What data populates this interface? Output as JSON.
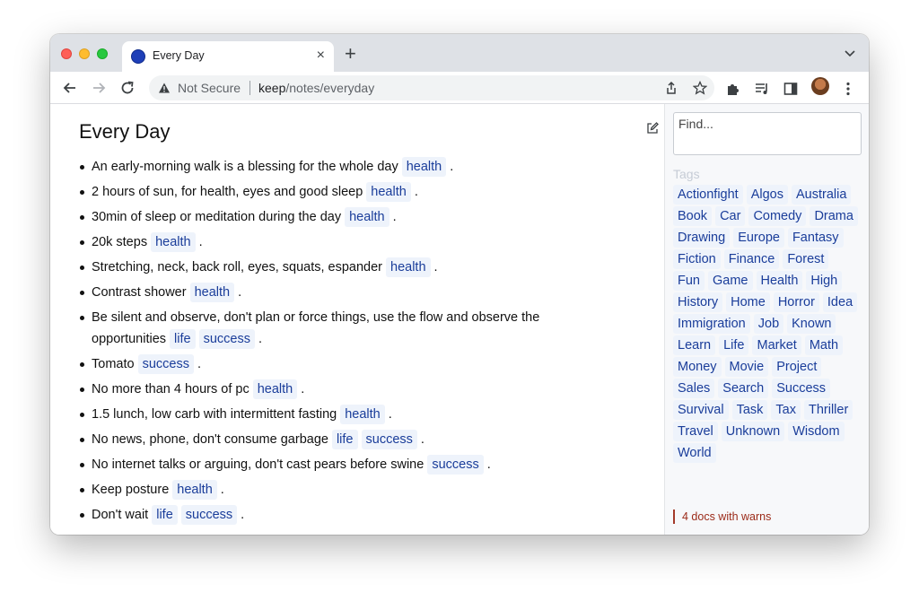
{
  "browser": {
    "tab_title": "Every Day",
    "tab_close": "×",
    "new_tab": "+",
    "security_label": "Not Secure",
    "url_host": "keep",
    "url_path": "/notes/everyday"
  },
  "page": {
    "title": "Every Day"
  },
  "notes": [
    {
      "text": "An early-morning walk is a blessing for the whole day",
      "tags": [
        "health"
      ]
    },
    {
      "text": "2 hours of sun, for health, eyes and good sleep",
      "tags": [
        "health"
      ]
    },
    {
      "text": "30min of sleep or meditation during the day",
      "tags": [
        "health"
      ]
    },
    {
      "text": "20k steps",
      "tags": [
        "health"
      ]
    },
    {
      "text": "Stretching, neck, back roll, eyes, squats, espander",
      "tags": [
        "health"
      ]
    },
    {
      "text": "Contrast shower",
      "tags": [
        "health"
      ]
    },
    {
      "text": "Be silent and observe, don't plan or force things, use the flow and observe the opportunities",
      "tags": [
        "life",
        "success"
      ]
    },
    {
      "text": "Tomato",
      "tags": [
        "success"
      ]
    },
    {
      "text": "No more than 4 hours of pc",
      "tags": [
        "health"
      ]
    },
    {
      "text": "1.5 lunch, low carb with intermittent fasting",
      "tags": [
        "health"
      ]
    },
    {
      "text": "No news, phone, don't consume garbage",
      "tags": [
        "life",
        "success"
      ]
    },
    {
      "text": "No internet talks or arguing, don't cast pears before swine",
      "tags": [
        "success"
      ]
    },
    {
      "text": "Keep posture",
      "tags": [
        "health"
      ]
    },
    {
      "text": "Don't wait",
      "tags": [
        "life",
        "success"
      ]
    }
  ],
  "sidebar": {
    "find_placeholder": "Find...",
    "tags_label": "Tags",
    "tags": [
      "Actionfight",
      "Algos",
      "Australia",
      "Book",
      "Car",
      "Comedy",
      "Drama",
      "Drawing",
      "Europe",
      "Fantasy",
      "Fiction",
      "Finance",
      "Forest",
      "Fun",
      "Game",
      "Health",
      "High",
      "History",
      "Home",
      "Horror",
      "Idea",
      "Immigration",
      "Job",
      "Known",
      "Learn",
      "Life",
      "Market",
      "Math",
      "Money",
      "Movie",
      "Project",
      "Sales",
      "Search",
      "Success",
      "Survival",
      "Task",
      "Tax",
      "Thriller",
      "Travel",
      "Unknown",
      "Wisdom",
      "World"
    ],
    "warn_text": "4 docs with warns"
  },
  "colors": {
    "tag_text": "#1a3d9a",
    "tag_bg": "#eef3fb",
    "warn": "#9b2a18"
  }
}
